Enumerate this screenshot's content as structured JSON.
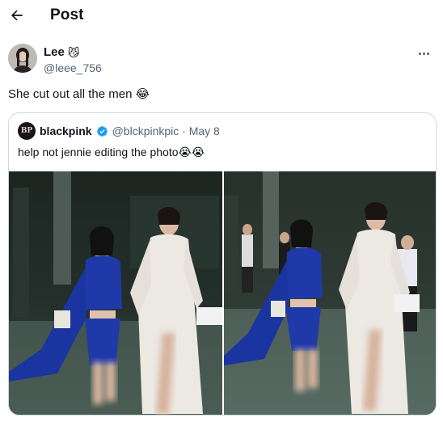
{
  "header": {
    "title": "Post",
    "back_icon": "arrow-left-icon"
  },
  "post": {
    "author_name": "Lee",
    "author_emoji": "😼",
    "author_handle": "@leee_756",
    "text": "She cut out all the men 😂",
    "more_icon": "more-dots-icon"
  },
  "quote": {
    "avatar_text": "BP",
    "name": "blackpink",
    "verified": true,
    "verified_color": "#1d9bf0",
    "handle_date": "@blckpinkpic · May 8",
    "text": "help not jennie editing the photo😭😭",
    "images": [
      {
        "label": "photo-left"
      },
      {
        "label": "photo-right"
      }
    ]
  },
  "colors": {
    "text_primary": "#0f1419",
    "text_secondary": "#536471",
    "border": "#cfd9de",
    "dress_blue": "#1f3aa8"
  }
}
